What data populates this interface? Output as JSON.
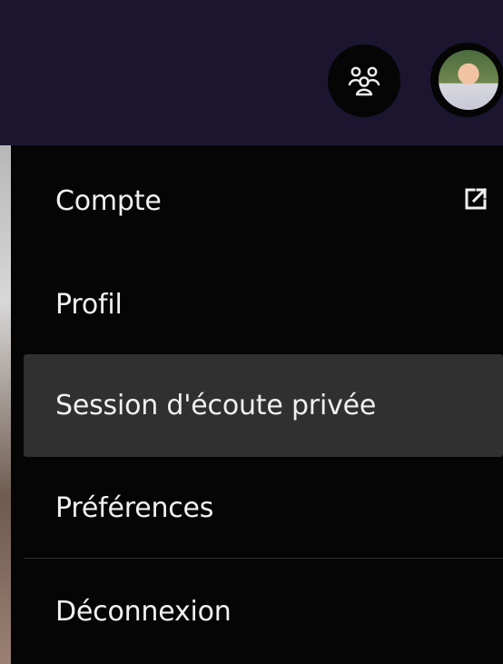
{
  "menu": {
    "items": [
      {
        "label": "Compte",
        "icon": "external-link-icon"
      },
      {
        "label": "Profil"
      },
      {
        "label": "Session d'écoute privée",
        "highlighted": true
      },
      {
        "label": "Préférences"
      },
      {
        "label": "Déconnexion"
      }
    ]
  },
  "header": {
    "friends_icon": "friends-activity-icon",
    "avatar_icon": "profile-avatar"
  },
  "colors": {
    "topbar": "#1c1530",
    "menu_background": "#050505",
    "highlight": "#303030",
    "text": "#f0f0f0"
  }
}
